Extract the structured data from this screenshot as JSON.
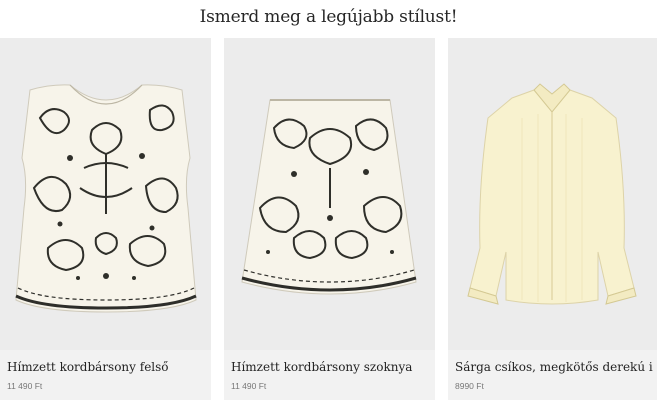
{
  "section": {
    "heading": "Ismerd meg a legújabb stílust!"
  },
  "products": [
    {
      "name": "Hímzett kordbársony felső",
      "price": "11 490 Ft",
      "image": "embroidered-top-image"
    },
    {
      "name": "Hímzett kordbársony szoknya",
      "price": "11 490 Ft",
      "image": "embroidered-skirt-image"
    },
    {
      "name": "Sárga csíkos, megkötős derekú ing",
      "price": "8990 Ft",
      "image": "yellow-shirt-image"
    }
  ]
}
